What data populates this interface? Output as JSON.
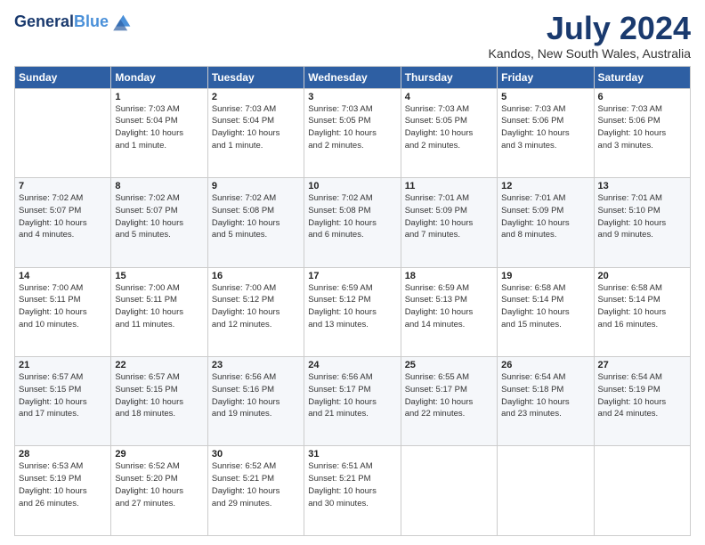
{
  "logo": {
    "line1": "General",
    "line2": "Blue"
  },
  "title": "July 2024",
  "location": "Kandos, New South Wales, Australia",
  "days_of_week": [
    "Sunday",
    "Monday",
    "Tuesday",
    "Wednesday",
    "Thursday",
    "Friday",
    "Saturday"
  ],
  "weeks": [
    [
      {
        "day": "",
        "content": ""
      },
      {
        "day": "1",
        "content": "Sunrise: 7:03 AM\nSunset: 5:04 PM\nDaylight: 10 hours\nand 1 minute."
      },
      {
        "day": "2",
        "content": "Sunrise: 7:03 AM\nSunset: 5:04 PM\nDaylight: 10 hours\nand 1 minute."
      },
      {
        "day": "3",
        "content": "Sunrise: 7:03 AM\nSunset: 5:05 PM\nDaylight: 10 hours\nand 2 minutes."
      },
      {
        "day": "4",
        "content": "Sunrise: 7:03 AM\nSunset: 5:05 PM\nDaylight: 10 hours\nand 2 minutes."
      },
      {
        "day": "5",
        "content": "Sunrise: 7:03 AM\nSunset: 5:06 PM\nDaylight: 10 hours\nand 3 minutes."
      },
      {
        "day": "6",
        "content": "Sunrise: 7:03 AM\nSunset: 5:06 PM\nDaylight: 10 hours\nand 3 minutes."
      }
    ],
    [
      {
        "day": "7",
        "content": "Sunrise: 7:02 AM\nSunset: 5:07 PM\nDaylight: 10 hours\nand 4 minutes."
      },
      {
        "day": "8",
        "content": "Sunrise: 7:02 AM\nSunset: 5:07 PM\nDaylight: 10 hours\nand 5 minutes."
      },
      {
        "day": "9",
        "content": "Sunrise: 7:02 AM\nSunset: 5:08 PM\nDaylight: 10 hours\nand 5 minutes."
      },
      {
        "day": "10",
        "content": "Sunrise: 7:02 AM\nSunset: 5:08 PM\nDaylight: 10 hours\nand 6 minutes."
      },
      {
        "day": "11",
        "content": "Sunrise: 7:01 AM\nSunset: 5:09 PM\nDaylight: 10 hours\nand 7 minutes."
      },
      {
        "day": "12",
        "content": "Sunrise: 7:01 AM\nSunset: 5:09 PM\nDaylight: 10 hours\nand 8 minutes."
      },
      {
        "day": "13",
        "content": "Sunrise: 7:01 AM\nSunset: 5:10 PM\nDaylight: 10 hours\nand 9 minutes."
      }
    ],
    [
      {
        "day": "14",
        "content": "Sunrise: 7:00 AM\nSunset: 5:11 PM\nDaylight: 10 hours\nand 10 minutes."
      },
      {
        "day": "15",
        "content": "Sunrise: 7:00 AM\nSunset: 5:11 PM\nDaylight: 10 hours\nand 11 minutes."
      },
      {
        "day": "16",
        "content": "Sunrise: 7:00 AM\nSunset: 5:12 PM\nDaylight: 10 hours\nand 12 minutes."
      },
      {
        "day": "17",
        "content": "Sunrise: 6:59 AM\nSunset: 5:12 PM\nDaylight: 10 hours\nand 13 minutes."
      },
      {
        "day": "18",
        "content": "Sunrise: 6:59 AM\nSunset: 5:13 PM\nDaylight: 10 hours\nand 14 minutes."
      },
      {
        "day": "19",
        "content": "Sunrise: 6:58 AM\nSunset: 5:14 PM\nDaylight: 10 hours\nand 15 minutes."
      },
      {
        "day": "20",
        "content": "Sunrise: 6:58 AM\nSunset: 5:14 PM\nDaylight: 10 hours\nand 16 minutes."
      }
    ],
    [
      {
        "day": "21",
        "content": "Sunrise: 6:57 AM\nSunset: 5:15 PM\nDaylight: 10 hours\nand 17 minutes."
      },
      {
        "day": "22",
        "content": "Sunrise: 6:57 AM\nSunset: 5:15 PM\nDaylight: 10 hours\nand 18 minutes."
      },
      {
        "day": "23",
        "content": "Sunrise: 6:56 AM\nSunset: 5:16 PM\nDaylight: 10 hours\nand 19 minutes."
      },
      {
        "day": "24",
        "content": "Sunrise: 6:56 AM\nSunset: 5:17 PM\nDaylight: 10 hours\nand 21 minutes."
      },
      {
        "day": "25",
        "content": "Sunrise: 6:55 AM\nSunset: 5:17 PM\nDaylight: 10 hours\nand 22 minutes."
      },
      {
        "day": "26",
        "content": "Sunrise: 6:54 AM\nSunset: 5:18 PM\nDaylight: 10 hours\nand 23 minutes."
      },
      {
        "day": "27",
        "content": "Sunrise: 6:54 AM\nSunset: 5:19 PM\nDaylight: 10 hours\nand 24 minutes."
      }
    ],
    [
      {
        "day": "28",
        "content": "Sunrise: 6:53 AM\nSunset: 5:19 PM\nDaylight: 10 hours\nand 26 minutes."
      },
      {
        "day": "29",
        "content": "Sunrise: 6:52 AM\nSunset: 5:20 PM\nDaylight: 10 hours\nand 27 minutes."
      },
      {
        "day": "30",
        "content": "Sunrise: 6:52 AM\nSunset: 5:21 PM\nDaylight: 10 hours\nand 29 minutes."
      },
      {
        "day": "31",
        "content": "Sunrise: 6:51 AM\nSunset: 5:21 PM\nDaylight: 10 hours\nand 30 minutes."
      },
      {
        "day": "",
        "content": ""
      },
      {
        "day": "",
        "content": ""
      },
      {
        "day": "",
        "content": ""
      }
    ]
  ]
}
